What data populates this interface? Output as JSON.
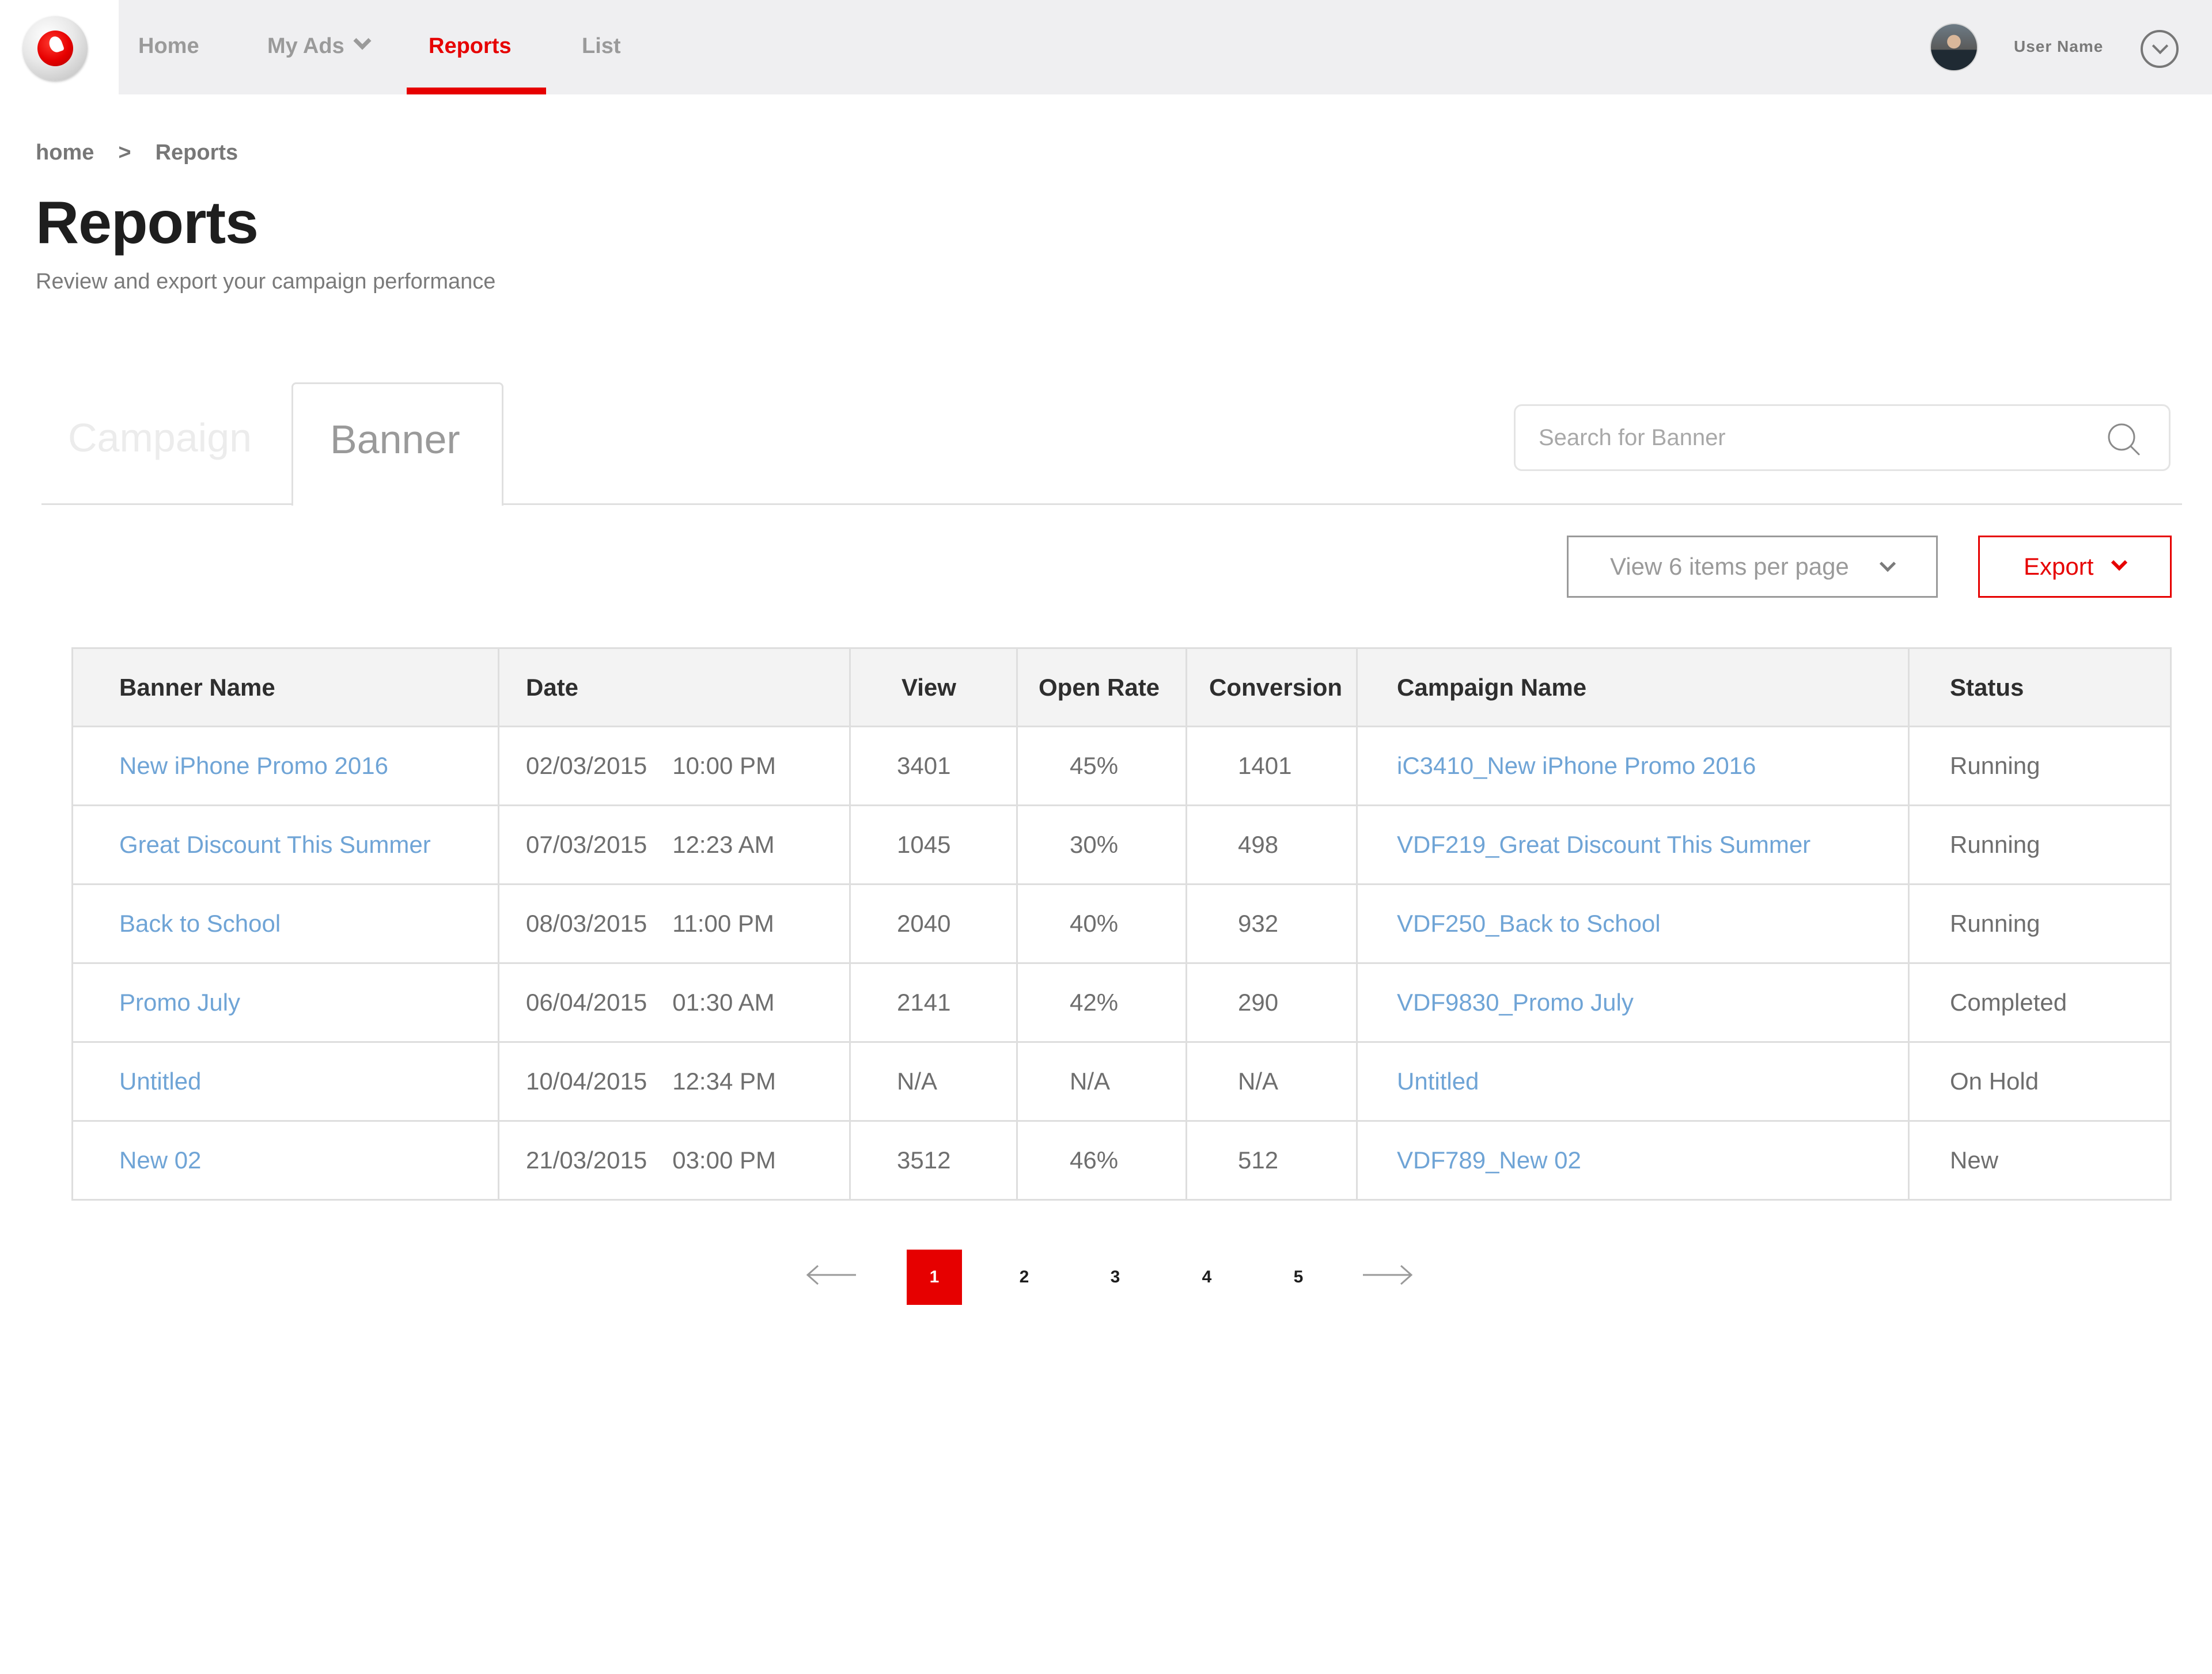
{
  "nav": {
    "home": "Home",
    "my_ads": "My Ads",
    "reports": "Reports",
    "list": "List",
    "user_name": "User Name",
    "active_color": "#e60000"
  },
  "breadcrumb": {
    "home": "home",
    "separator": ">",
    "current": "Reports"
  },
  "page": {
    "title": "Reports",
    "subtitle": "Review and export your campaign performance"
  },
  "tabs": {
    "campaign": "Campaign",
    "banner": "Banner",
    "active": "Banner"
  },
  "search": {
    "placeholder": "Search for Banner"
  },
  "controls": {
    "per_page": "View 6 items per page",
    "export": "Export"
  },
  "table": {
    "headers": {
      "banner_name": "Banner Name",
      "date": "Date",
      "view": "View",
      "open_rate": "Open Rate",
      "conversion": "Conversion",
      "campaign_name": "Campaign Name",
      "status": "Status"
    },
    "rows": [
      {
        "banner": "New iPhone Promo 2016",
        "date": "02/03/2015",
        "time": "10:00 PM",
        "view": "3401",
        "open_rate": "45%",
        "conversion": "1401",
        "campaign": "iC3410_New iPhone Promo 2016",
        "status": "Running"
      },
      {
        "banner": "Great Discount This Summer",
        "date": "07/03/2015",
        "time": "12:23 AM",
        "view": "1045",
        "open_rate": "30%",
        "conversion": "498",
        "campaign": "VDF219_Great Discount This Summer",
        "status": "Running"
      },
      {
        "banner": "Back to School",
        "date": "08/03/2015",
        "time": "11:00 PM",
        "view": "2040",
        "open_rate": "40%",
        "conversion": "932",
        "campaign": "VDF250_Back to School",
        "status": "Running"
      },
      {
        "banner": "Promo July",
        "date": "06/04/2015",
        "time": "01:30 AM",
        "view": "2141",
        "open_rate": "42%",
        "conversion": "290",
        "campaign": "VDF9830_Promo July",
        "status": "Completed"
      },
      {
        "banner": "Untitled",
        "date": "10/04/2015",
        "time": "12:34 PM",
        "view": "N/A",
        "open_rate": "N/A",
        "conversion": "N/A",
        "campaign": "Untitled",
        "status": "On Hold"
      },
      {
        "banner": "New 02",
        "date": "21/03/2015",
        "time": "03:00 PM",
        "view": "3512",
        "open_rate": "46%",
        "conversion": "512",
        "campaign": "VDF789_New 02",
        "status": "New"
      }
    ]
  },
  "pagination": {
    "pages": [
      "1",
      "2",
      "3",
      "4",
      "5"
    ],
    "current": "1"
  },
  "icons": {
    "logo": "vodafone-logo-icon",
    "search": "search-icon",
    "user_menu": "chevron-down-circle-icon",
    "prev": "arrow-left-icon",
    "next": "arrow-right-icon"
  }
}
